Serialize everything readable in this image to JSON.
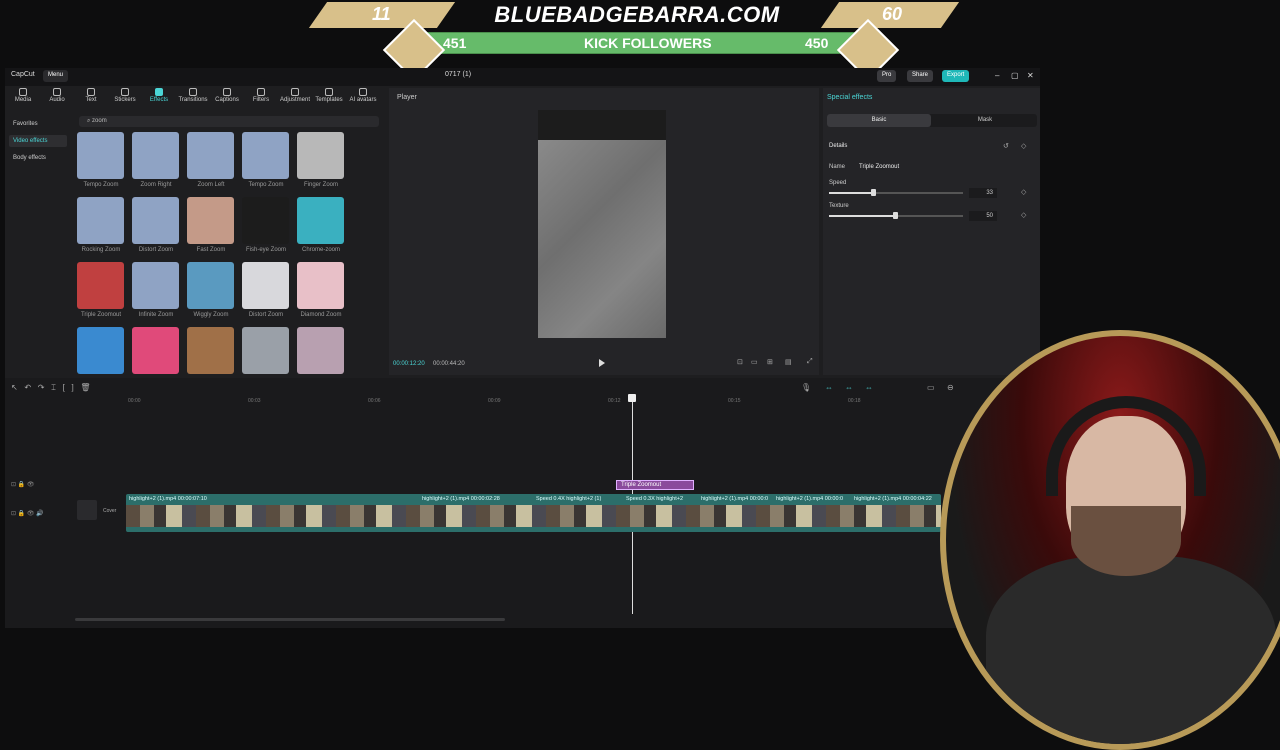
{
  "banner": {
    "left_number": "11",
    "title": "BLUEBADGEBARRA.COM",
    "right_number": "60",
    "follower_left": "451",
    "follower_label": "KICK FOLLOWERS",
    "follower_right": "450"
  },
  "titlebar": {
    "app_name": "CapCut",
    "menu": "Menu",
    "project": "0717 (1)",
    "pro": "Pro",
    "share": "Share",
    "export": "Export"
  },
  "toolbar": {
    "items": [
      {
        "label": "Media"
      },
      {
        "label": "Audio"
      },
      {
        "label": "Text"
      },
      {
        "label": "Stickers"
      },
      {
        "label": "Effects"
      },
      {
        "label": "Transitions"
      },
      {
        "label": "Captions"
      },
      {
        "label": "Filters"
      },
      {
        "label": "Adjustment"
      },
      {
        "label": "Templates"
      },
      {
        "label": "AI avatars"
      }
    ],
    "active": "Effects"
  },
  "sidebar": {
    "items": [
      {
        "label": "Favorites"
      },
      {
        "label": "Video effects"
      },
      {
        "label": "Body effects"
      }
    ]
  },
  "search": {
    "value": "zoom"
  },
  "effects": [
    {
      "label": "Tempo Zoom",
      "color": "#8fa3c4"
    },
    {
      "label": "Zoom Right",
      "color": "#8fa3c4"
    },
    {
      "label": "Zoom Left",
      "color": "#8fa3c4"
    },
    {
      "label": "Tempo Zoom",
      "color": "#8fa3c4"
    },
    {
      "label": "Finger Zoom",
      "color": "#b8b8b8"
    },
    {
      "label": "Rocking Zoom",
      "color": "#8fa3c4"
    },
    {
      "label": "Distort Zoom",
      "color": "#8fa3c4"
    },
    {
      "label": "Fast Zoom",
      "color": "#c49a88"
    },
    {
      "label": "Fish-eye Zoom",
      "color": "#1c1c1c"
    },
    {
      "label": "Chrome-zoom",
      "color": "#3ab0c0"
    },
    {
      "label": "Triple Zoomout",
      "color": "#c04040"
    },
    {
      "label": "Infinite Zoom",
      "color": "#8fa3c4"
    },
    {
      "label": "Wiggly Zoom",
      "color": "#5a9ac0"
    },
    {
      "label": "Distort Zoom",
      "color": "#d8d8dc"
    },
    {
      "label": "Diamond Zoom",
      "color": "#e8c0c8"
    },
    {
      "label": "",
      "color": "#3a8ad0"
    },
    {
      "label": "",
      "color": "#e04a7a"
    },
    {
      "label": "",
      "color": "#a07048"
    },
    {
      "label": "",
      "color": "#9aa0a8"
    },
    {
      "label": "",
      "color": "#b8a0b0"
    }
  ],
  "player": {
    "title": "Player",
    "current_time": "00:00:12:20",
    "total_time": "00:00:44:20"
  },
  "special_effects": {
    "title": "Special effects",
    "tab_basic": "Basic",
    "tab_mask": "Mask",
    "details": "Details",
    "name_label": "Name",
    "name_value": "Triple Zoomout",
    "speed_label": "Speed",
    "speed_value": "33",
    "texture_label": "Texture",
    "texture_value": "50"
  },
  "timeline": {
    "ruler": [
      "00:00",
      "00:03",
      "00:06",
      "00:09",
      "00:12",
      "00:15",
      "00:18"
    ],
    "effect_clip": "Triple Zoomout",
    "clip_labels": [
      "highlight+2 (1).mp4  00:00:07:10",
      "highlight+2 (1).mp4  00:00:02:28",
      "Speed 0.4X  highlight+2 (1)",
      "Speed 0.3X  highlight+2",
      "highlight+2 (1).mp4  00:00:0",
      "highlight+2 (1).mp4  00:00:0",
      "highlight+2 (1).mp4  00:00:04:22"
    ],
    "cover": "Cover"
  },
  "colors": {
    "accent": "#4bd6d6",
    "panel": "#242427"
  }
}
